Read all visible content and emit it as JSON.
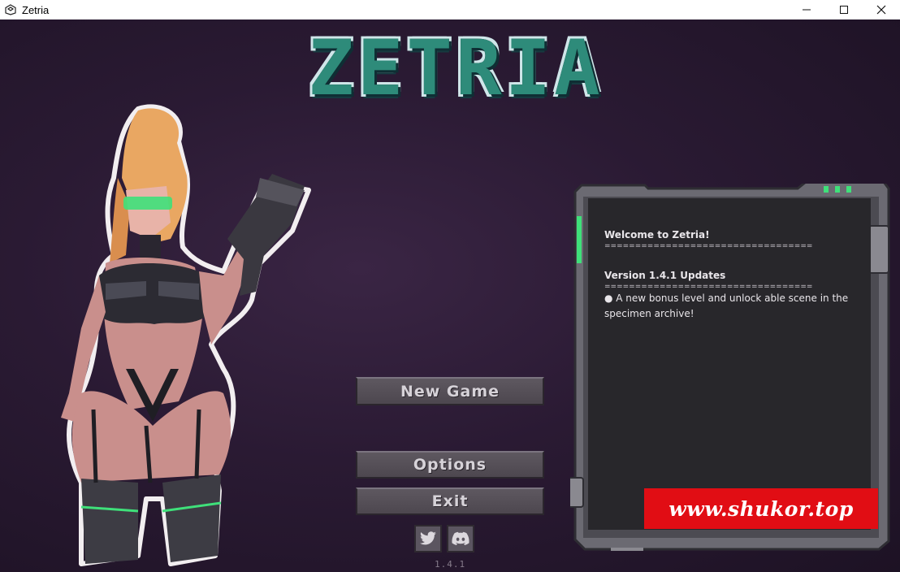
{
  "window": {
    "title": "Zetria",
    "icon": "unity-icon",
    "controls": [
      "minimize-icon",
      "maximize-icon",
      "close-icon"
    ]
  },
  "game": {
    "logo": "ZETRIA",
    "menu": {
      "new_game": "New Game",
      "options": "Options",
      "exit": "Exit"
    },
    "social": [
      "twitter-icon",
      "discord-icon"
    ],
    "version": "1.4.1"
  },
  "panel": {
    "welcome": "Welcome to Zetria!",
    "rule": "==================================",
    "version_heading": "Version 1.4.1 Updates",
    "bullet": "● A new bonus level and unlock able scene in the specimen archive!"
  },
  "watermark": "www.shukor.top",
  "colors": {
    "background": "#2a1a33",
    "logo": "#2e8b7a",
    "button": "#5e5860",
    "panel_screen": "#28272b",
    "watermark": "#e10d14"
  }
}
